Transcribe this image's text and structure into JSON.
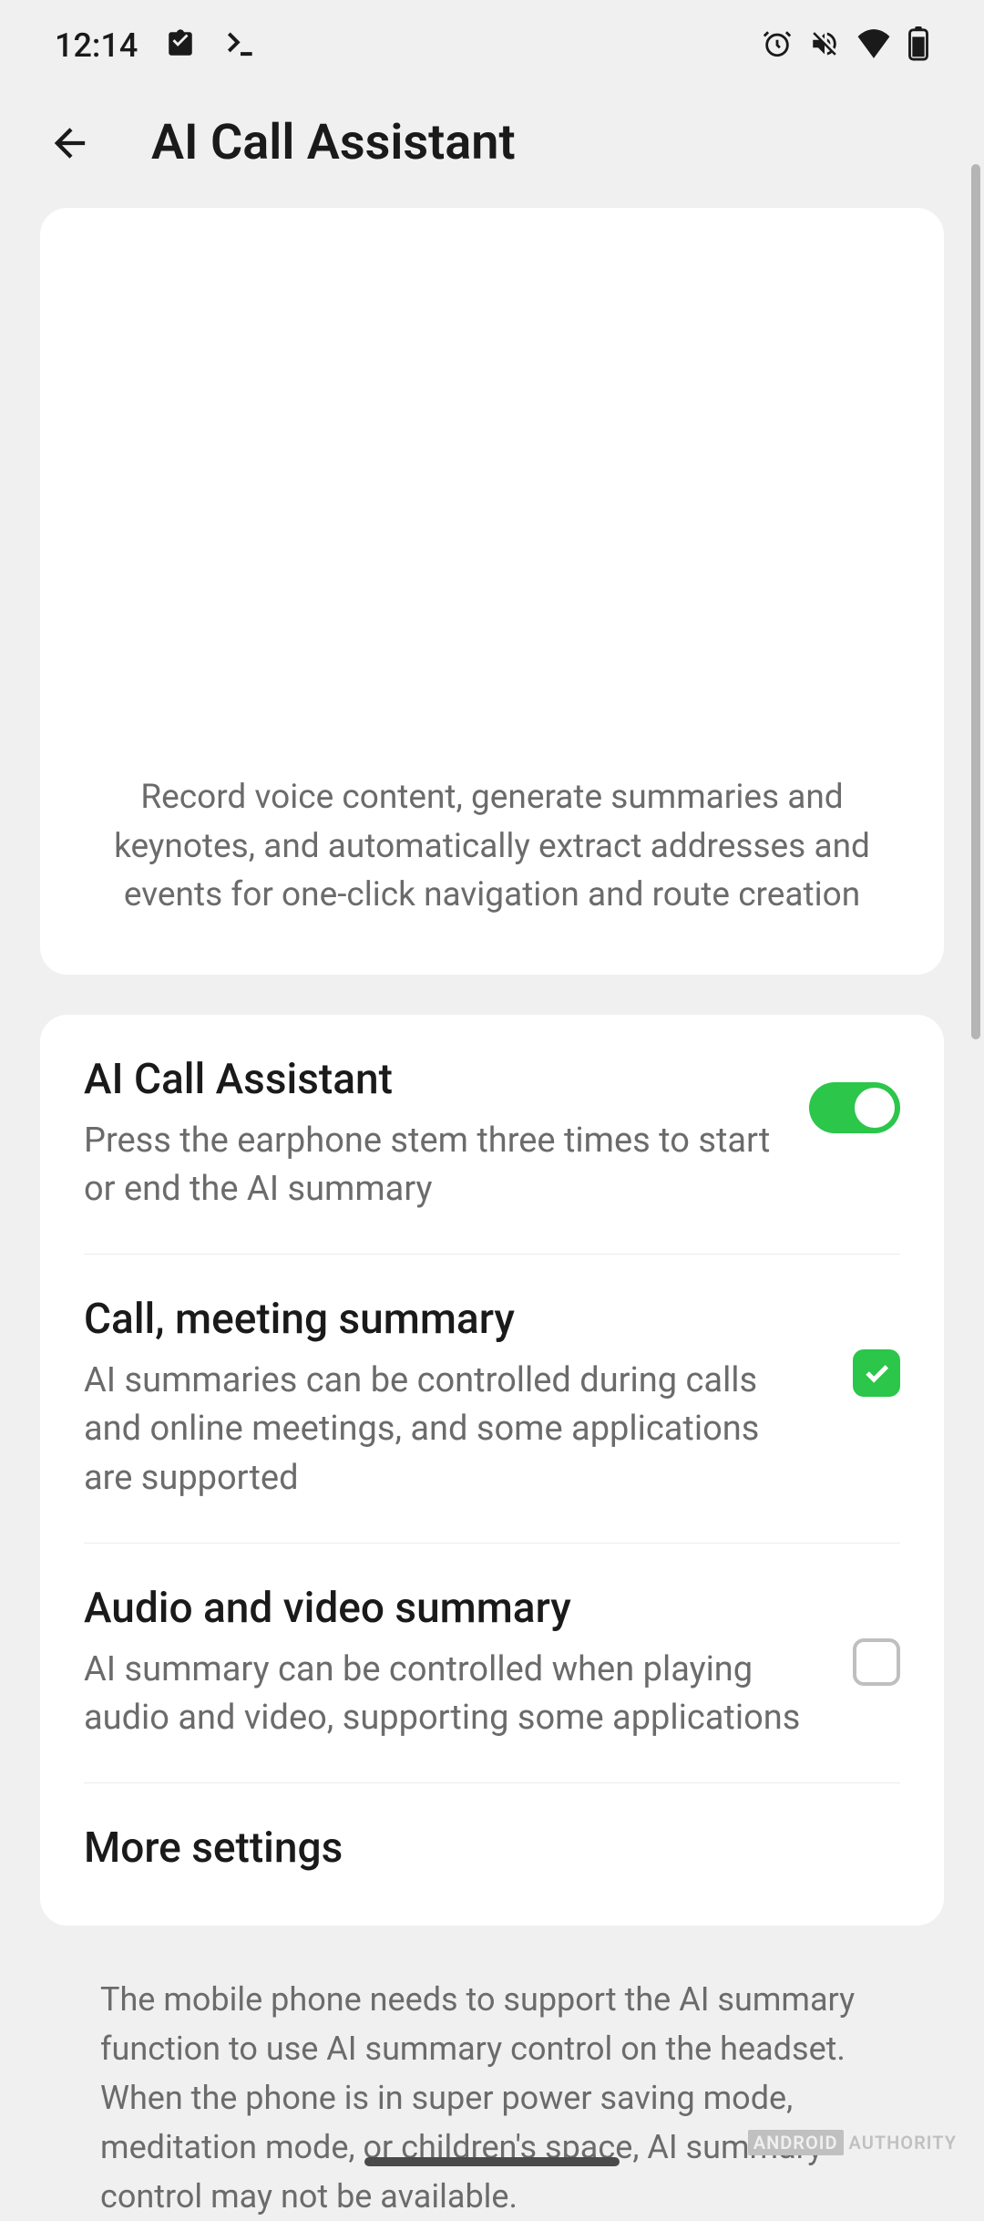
{
  "statusbar": {
    "time": "12:14"
  },
  "header": {
    "title": "AI Call Assistant"
  },
  "intro": {
    "text": "Record voice content, generate summaries and keynotes, and automatically extract addresses and events for one-click navigation and route creation"
  },
  "settings": [
    {
      "title": "AI Call Assistant",
      "desc": "Press the earphone stem three times to start or end the AI summary",
      "control": "toggle",
      "value": true
    },
    {
      "title": "Call, meeting summary",
      "desc": "AI summaries can be controlled during calls and online meetings, and some applications are supported",
      "control": "checkbox",
      "value": true
    },
    {
      "title": "Audio and video summary",
      "desc": "AI summary can be controlled when playing audio and video, supporting some applications",
      "control": "checkbox",
      "value": false
    },
    {
      "title": "More settings",
      "desc": "",
      "control": "none",
      "value": null
    }
  ],
  "footer": {
    "line1": "The mobile phone needs to support the AI summary function to use AI summary control on the headset.",
    "line2": "When the phone is in super power saving mode, meditation mode, or children's space, AI summary control may not be available."
  },
  "watermark": {
    "bold": "ANDROID",
    "light": "AUTHORITY"
  }
}
